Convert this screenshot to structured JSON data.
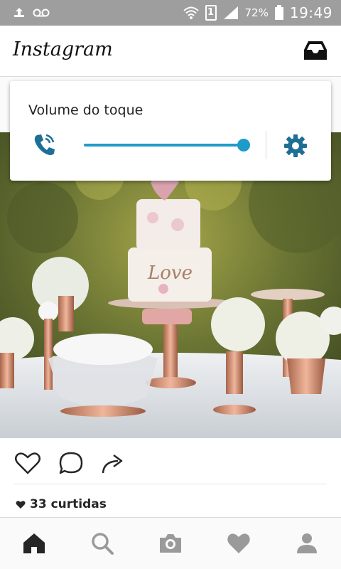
{
  "status_bar": {
    "battery_percent": "72%",
    "time": "19:49",
    "sim_slot": "1",
    "icons": [
      "usb-icon",
      "voicemail-icon",
      "wifi-icon",
      "sim-icon",
      "signal-icon",
      "battery-icon"
    ]
  },
  "header": {
    "logo": "Instagram",
    "icons": [
      "inbox-icon"
    ]
  },
  "volume_popup": {
    "title": "Volume do toque",
    "level": 1.0,
    "accent_color": "#1e9bc7",
    "icons": [
      "ringer-phone-icon",
      "settings-gear-icon"
    ]
  },
  "post": {
    "image": {
      "description_icon": "photo-image"
    },
    "actions": {
      "icons": [
        "heart-outline-icon",
        "comment-icon",
        "share-arrow-icon"
      ]
    },
    "likes": {
      "text": "33 curtidas",
      "icon": "heart-filled-icon"
    }
  },
  "bottom_nav": {
    "items": [
      {
        "icon": "home-icon",
        "active": true
      },
      {
        "icon": "search-icon",
        "active": false
      },
      {
        "icon": "camera-icon",
        "active": false
      },
      {
        "icon": "heart-icon",
        "active": false
      },
      {
        "icon": "profile-icon",
        "active": false
      }
    ]
  }
}
